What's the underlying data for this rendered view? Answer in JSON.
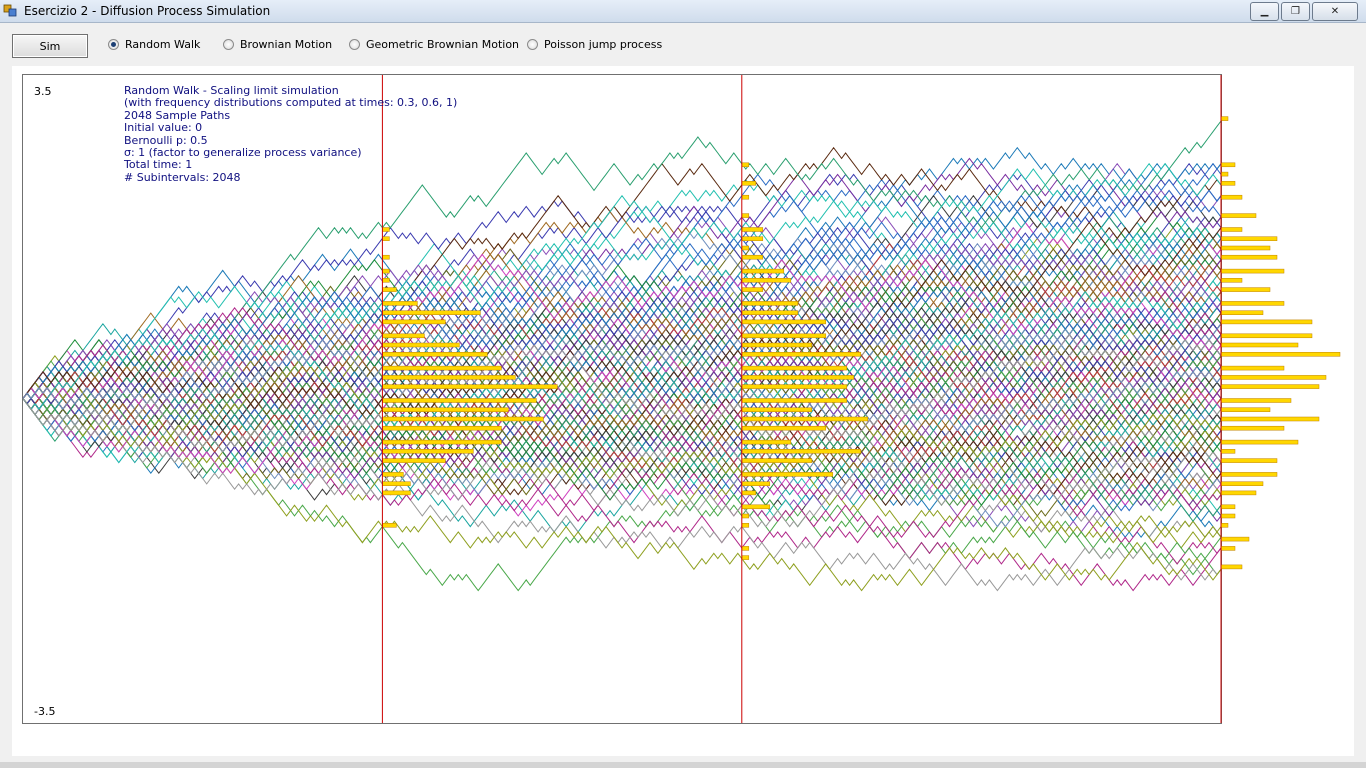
{
  "window": {
    "title": "Esercizio 2 - Diffusion Process Simulation"
  },
  "toolbar": {
    "sim_label": "Sim",
    "options": [
      {
        "label": "Random Walk",
        "selected": true
      },
      {
        "label": "Brownian Motion",
        "selected": false
      },
      {
        "label": "Geometric Brownian Motion",
        "selected": false
      },
      {
        "label": "Poisson jump process",
        "selected": false
      }
    ]
  },
  "info": {
    "line1": "Random Walk - Scaling limit simulation",
    "line2": "(with frequency distributions computed at times: 0.3, 0.6, 1)",
    "line3": "2048 Sample Paths",
    "line4": "Initial value: 0",
    "line5": "Bernoulli p: 0.5",
    "line6": "σ: 1 (factor to generalize process variance)",
    "line7": "Total time: 1",
    "line8": "# Subintervals: 2048"
  },
  "chart_data": {
    "type": "line",
    "ylim": [
      -3.5,
      3.5
    ],
    "y_max_label": "3.5",
    "y_min_label": "-3.5",
    "xlim": [
      0,
      1
    ],
    "snapshot_times": [
      0.3,
      0.6,
      1
    ],
    "sample_paths": 2048,
    "initial_value": 0,
    "bernoulli_p": 0.5,
    "sigma": 1,
    "subintervals": 2048,
    "snapshot_line_color": "#cc0000",
    "histogram_color": "#ffd700",
    "histogram_border": "#c08000"
  }
}
